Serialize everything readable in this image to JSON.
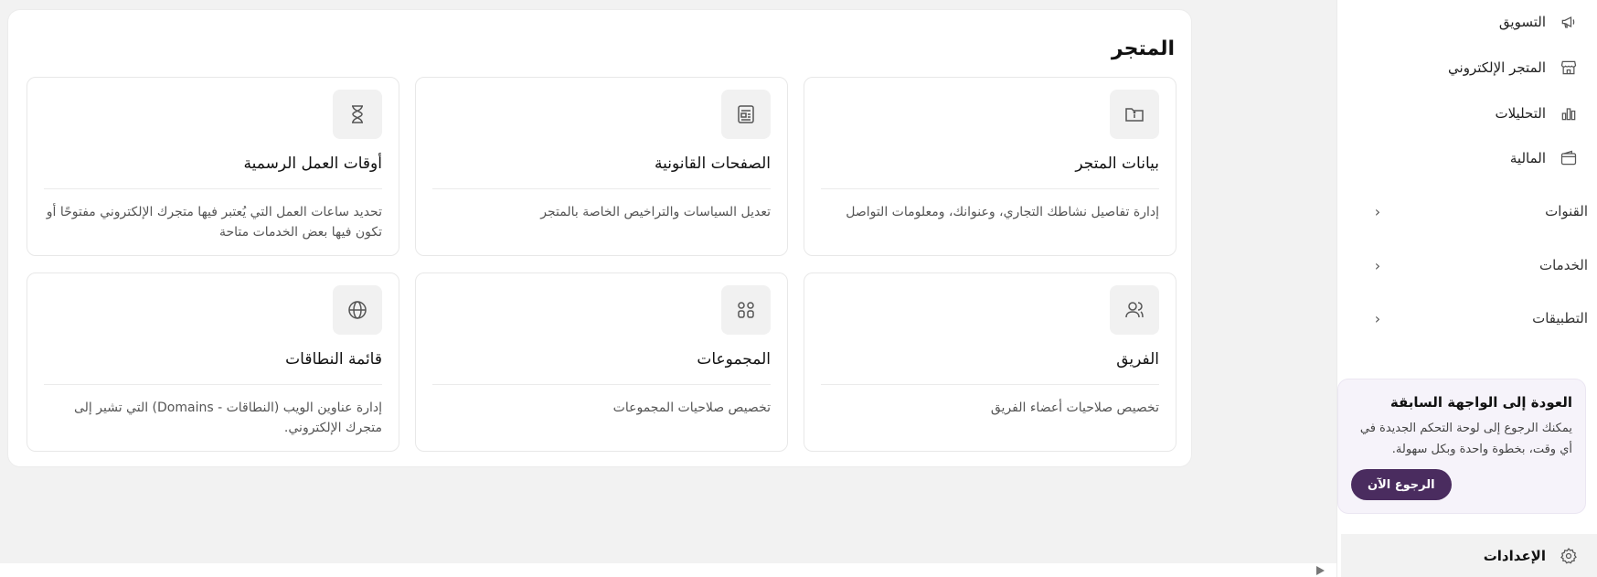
{
  "page": {
    "title": "المتجر"
  },
  "cards": [
    {
      "title": "بيانات المتجر",
      "description": "إدارة تفاصيل نشاطك التجاري، وعنوانك، ومعلومات التواصل",
      "icon": "store-info-icon"
    },
    {
      "title": "الصفحات القانونية",
      "description": "تعديل السياسات والتراخيص الخاصة بالمتجر",
      "icon": "legal-page-icon"
    },
    {
      "title": "أوقات العمل الرسمية",
      "description": "تحديد ساعات العمل التي يُعتبر فيها متجرك الإلكتروني مفتوحًا أو تكون فيها بعض الخدمات متاحة",
      "icon": "hourglass-icon"
    },
    {
      "title": "الفريق",
      "description": "تخصيص صلاحيات أعضاء الفريق",
      "icon": "team-icon"
    },
    {
      "title": "المجموعات",
      "description": "تخصيص صلاحيات المجموعات",
      "icon": "groups-icon"
    },
    {
      "title": "قائمة النطاقات",
      "description": "إدارة عناوين الويب (النطاقات - Domains) التي تشير إلى متجرك الإلكتروني.",
      "icon": "globe-icon"
    }
  ],
  "sidebar": {
    "items": [
      {
        "label": "التسويق",
        "icon": "megaphone-icon"
      },
      {
        "label": "المتجر الإلكتروني",
        "icon": "storefront-icon"
      },
      {
        "label": "التحليلات",
        "icon": "bar-chart-icon"
      },
      {
        "label": "المالية",
        "icon": "wallet-icon"
      }
    ],
    "groups": [
      {
        "label": "القنوات",
        "icon": "chevron-left-icon"
      },
      {
        "label": "الخدمات",
        "icon": "chevron-left-icon"
      },
      {
        "label": "التطبيقات",
        "icon": "chevron-left-icon"
      }
    ],
    "promo": {
      "title": "العودة إلى الواجهة السابقة",
      "body": "يمكنك الرجوع إلى لوحة التحكم الجديدة في أي وقت، بخطوة واحدة وبكل سهولة.",
      "button": "الرجوع الآن"
    },
    "settings": {
      "label": "الإعدادات",
      "icon": "gear-icon"
    }
  },
  "colors": {
    "accent": "#4a2c5f",
    "background": "#f2f2f2",
    "card_border": "#e8e8e8"
  }
}
